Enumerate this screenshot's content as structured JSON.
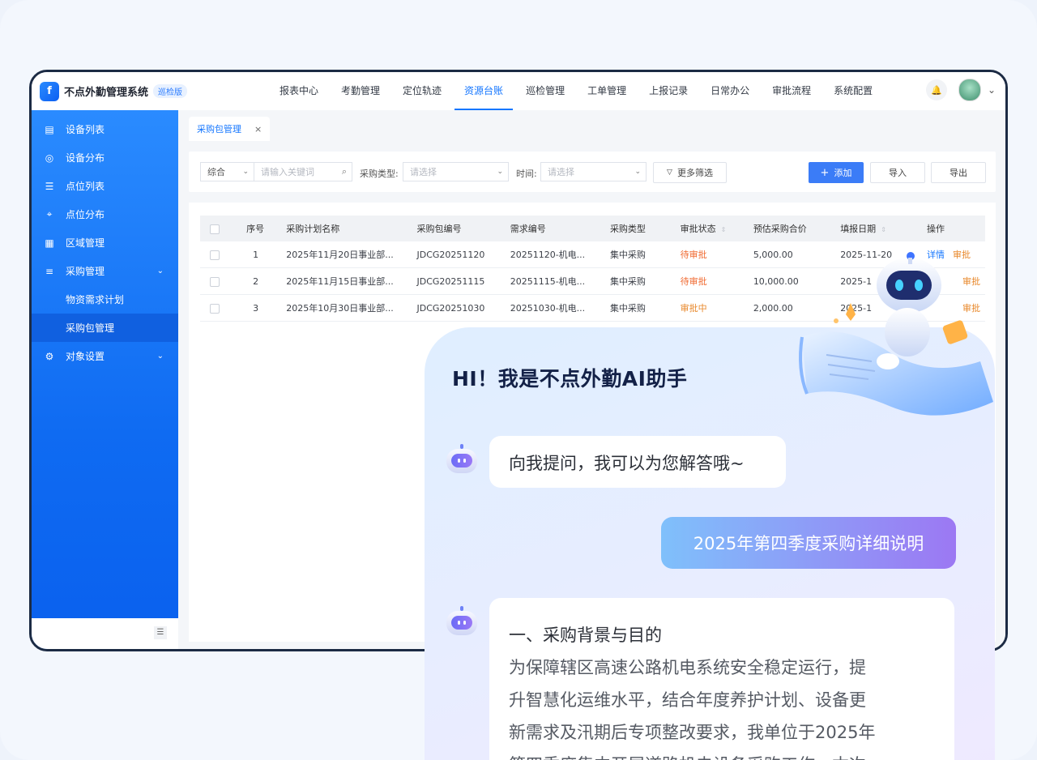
{
  "app": {
    "title": "不点外勤管理系统",
    "badge": "巡检版",
    "logo_glyph": "f"
  },
  "nav": [
    "报表中心",
    "考勤管理",
    "定位轨迹",
    "资源台账",
    "巡检管理",
    "工单管理",
    "上报记录",
    "日常办公",
    "审批流程",
    "系统配置"
  ],
  "nav_active_index": 3,
  "topbar": {
    "bell_glyph": "🔔",
    "caret": "⌄"
  },
  "sidebar": {
    "items": [
      {
        "label": "设备列表",
        "icon": "▤"
      },
      {
        "label": "设备分布",
        "icon": "◎"
      },
      {
        "label": "点位列表",
        "icon": "☰"
      },
      {
        "label": "点位分布",
        "icon": "⌖"
      },
      {
        "label": "区域管理",
        "icon": "▦"
      },
      {
        "label": "采购管理",
        "icon": "≡",
        "chevron": "⌄"
      },
      {
        "label": "物资需求计划"
      },
      {
        "label": "采购包管理"
      },
      {
        "label": "对象设置",
        "icon": "⚙",
        "chevron": "⌄"
      }
    ],
    "fold_glyph": "☰"
  },
  "tab": {
    "label": "采购包管理",
    "close": "×"
  },
  "filter": {
    "sort_select": "综合",
    "keyword_placeholder": "请输入关键词",
    "type_label": "采购类型:",
    "type_placeholder": "请选择",
    "time_label": "时间:",
    "time_placeholder": "请选择",
    "more_label": "更多筛选",
    "add_label": "添加",
    "import_label": "导入",
    "export_label": "导出",
    "dropdown_glyph": "⌄",
    "search_glyph": "⌕",
    "funnel_glyph": "▽",
    "plus_glyph": "+"
  },
  "table": {
    "headers": [
      "序号",
      "采购计划名称",
      "采购包编号",
      "需求编号",
      "采购类型",
      "审批状态",
      "预估采购合价",
      "填报日期",
      "操作"
    ],
    "sort_glyph": "⇕",
    "rows": [
      {
        "no": "1",
        "plan": "2025年11月20日事业部...",
        "pkg": "JDCG20251120",
        "req": "20251120-机电...",
        "type": "集中采购",
        "status": "待审批",
        "amount": "5,000.00",
        "date": "2025-11-20",
        "op1": "详情",
        "op2": "审批"
      },
      {
        "no": "2",
        "plan": "2025年11月15日事业部...",
        "pkg": "JDCG20251115",
        "req": "20251115-机电...",
        "type": "集中采购",
        "status": "待审批",
        "amount": "10,000.00",
        "date": "2025-1",
        "op1": "",
        "op2": "审批"
      },
      {
        "no": "3",
        "plan": "2025年10月30日事业部...",
        "pkg": "JDCG20251030",
        "req": "20251030-机电...",
        "type": "集中采购",
        "status": "审批中",
        "amount": "2,000.00",
        "date": "2025-1",
        "op1": "",
        "op2": "审批"
      }
    ]
  },
  "chat": {
    "title": "HI！我是不点外勤AI助手",
    "bot_greeting": "向我提问，我可以为您解答哦~",
    "user_message": "2025年第四季度采购详细说明",
    "answer_heading": "一、采购背景与目的",
    "answer_lines": [
      "为保障辖区高速公路机电系统安全稳定运行，提",
      "升智慧化运维水平，结合年度养护计划、设备更",
      "新需求及汛期后专项整改要求，我单位于2025年",
      "第四季度集中开展道路机电设备采购工作。本次"
    ]
  },
  "colors": {
    "primary": "#1677ff",
    "pending": "#f06a31",
    "processing": "#e8882b",
    "sidebar": "#1a7cf8"
  }
}
